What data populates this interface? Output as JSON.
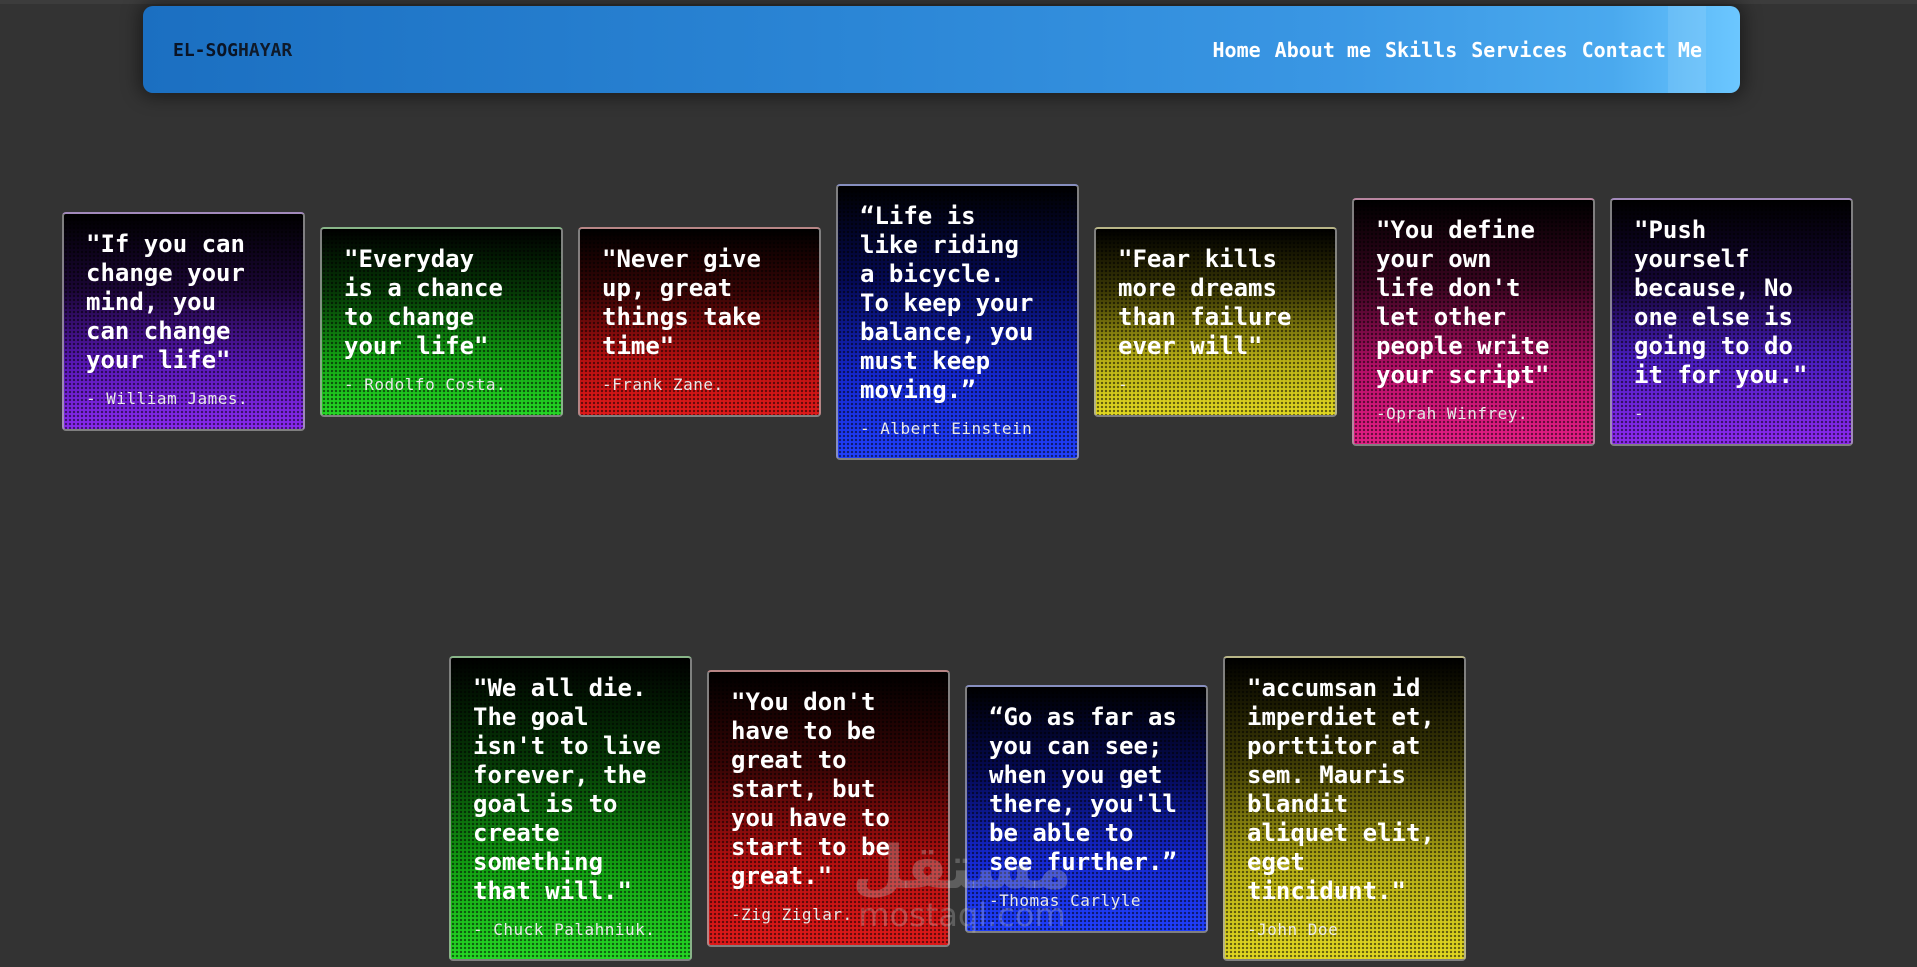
{
  "header": {
    "logo_part1": "EL-SOG",
    "logo_part2": "HAYAR",
    "nav": [
      "Home",
      "About me",
      "Skills",
      "Services",
      "Contact Me"
    ]
  },
  "cards_row1": [
    {
      "quote": "\"If you can\nchange your\nmind, you\ncan change\nyour life\"",
      "author": "- William James.",
      "color": "purple"
    },
    {
      "quote": "\"Everyday\nis a chance\nto change\nyour life\"",
      "author": "- Rodolfo Costa.",
      "color": "green"
    },
    {
      "quote": "\"Never give\nup, great\nthings take\ntime\"",
      "author": "-Frank Zane.",
      "color": "red"
    },
    {
      "quote": "“Life is\nlike riding\na bicycle.\nTo keep your\nbalance, you\nmust keep\nmoving.”",
      "author": "- Albert Einstein",
      "color": "blue"
    },
    {
      "quote": "\"Fear kills\nmore dreams\nthan failure\never will\"",
      "author": "-",
      "color": "yellow"
    },
    {
      "quote": "\"You define\nyour own\nlife don't\nlet other\npeople write\nyour script\"",
      "author": "-Oprah Winfrey.",
      "color": "pink"
    },
    {
      "quote": "\"Push\nyourself\nbecause, No\none else is\ngoing to do\nit for you.\"",
      "author": "-",
      "color": "purple"
    }
  ],
  "cards_row2": [
    {
      "quote": "\"We all die.\nThe goal\nisn't to live\nforever, the\ngoal is to\ncreate\nsomething\nthat will.\"",
      "author": "- Chuck Palahniuk.",
      "color": "green"
    },
    {
      "quote": "\"You don't\nhave to be\ngreat to\nstart, but\nyou have to\nstart to be\ngreat.\"",
      "author": "-Zig Ziglar.",
      "color": "red"
    },
    {
      "quote": "“Go as far as\nyou can see;\nwhen you get\nthere, you'll\nbe able to\nsee further.”",
      "author": "-Thomas Carlyle",
      "color": "blue"
    },
    {
      "quote": "\"accumsan id\nimperdiet et,\nporttitor at\nsem. Mauris\nblandit\naliquet elit,\neget\ntincidunt.\"",
      "author": "-John Doe",
      "color": "yellow"
    }
  ],
  "watermark": {
    "arabic": "مستقل",
    "latin": "mostaql.com"
  }
}
